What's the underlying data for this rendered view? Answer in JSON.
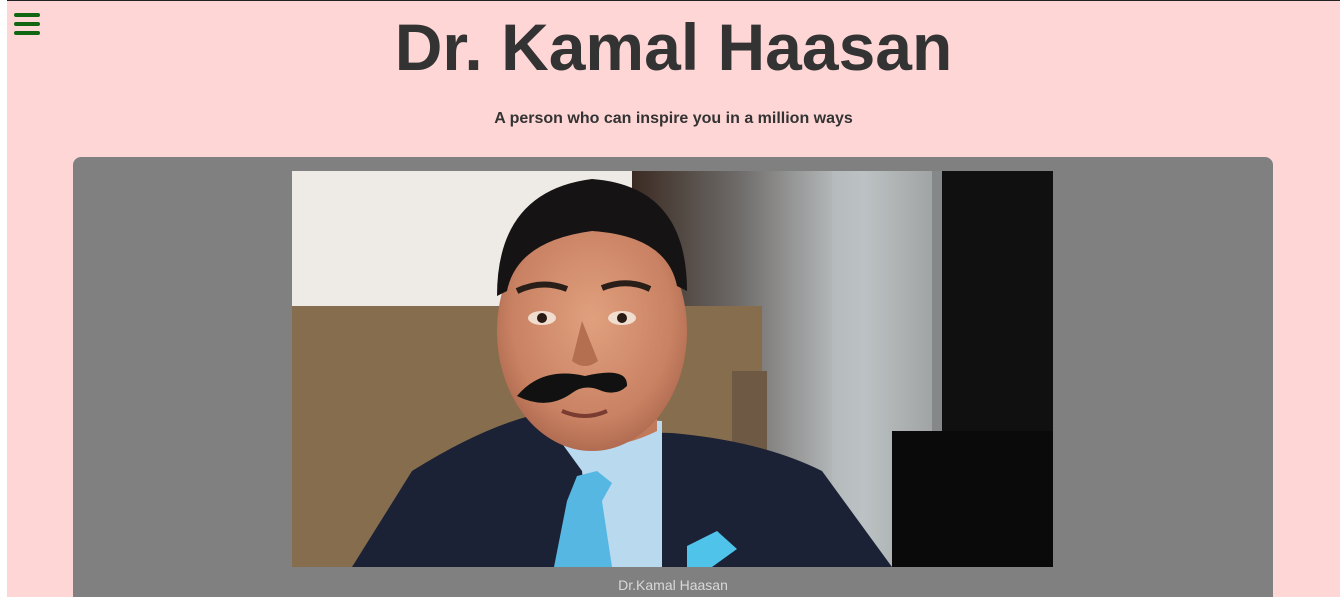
{
  "header": {
    "menu_icon": "hamburger-menu-icon",
    "title": "Dr. Kamal Haasan",
    "tagline": "A person who can inspire you in a million ways"
  },
  "figure": {
    "caption": "Dr.Kamal Haasan"
  },
  "colors": {
    "page_background": "#ffd6d6",
    "card_background": "#808080",
    "title_text": "#333333",
    "menu_icon": "#116611",
    "caption_text": "#d8d8d8"
  }
}
